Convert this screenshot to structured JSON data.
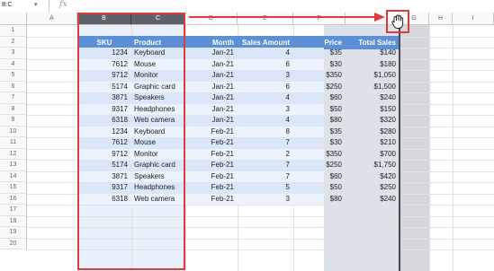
{
  "formula_bar": {
    "name_box": "B:C",
    "name_box_arrow": "▾",
    "fx_label": "fx"
  },
  "columns": [
    "A",
    "B",
    "C",
    "D",
    "E",
    "F",
    "G",
    "H",
    "I"
  ],
  "rows": [
    "1",
    "2",
    "3",
    "4",
    "5",
    "6",
    "7",
    "8",
    "9",
    "10",
    "11",
    "12",
    "13",
    "14",
    "15",
    "16",
    "17",
    "18",
    "19",
    "20"
  ],
  "table": {
    "headers": [
      "SKU",
      "Product",
      "Month",
      "Sales Amount",
      "Price",
      "Total Sales"
    ],
    "rows": [
      [
        "1234",
        "Keyboard",
        "Jan-21",
        "4",
        "$35",
        "$140"
      ],
      [
        "7612",
        "Mouse",
        "Jan-21",
        "6",
        "$30",
        "$180"
      ],
      [
        "9712",
        "Monitor",
        "Jan-21",
        "3",
        "$350",
        "$1,050"
      ],
      [
        "5174",
        "Graphic card",
        "Jan-21",
        "6",
        "$250",
        "$1,500"
      ],
      [
        "3871",
        "Speakers",
        "Jan-21",
        "4",
        "$60",
        "$240"
      ],
      [
        "9317",
        "Headphones",
        "Jan-21",
        "3",
        "$50",
        "$150"
      ],
      [
        "6318",
        "Web camera",
        "Jan-21",
        "4",
        "$80",
        "$320"
      ],
      [
        "1234",
        "Keyboard",
        "Feb-21",
        "8",
        "$35",
        "$280"
      ],
      [
        "7612",
        "Mouse",
        "Feb-21",
        "7",
        "$30",
        "$210"
      ],
      [
        "9712",
        "Monitor",
        "Feb-21",
        "2",
        "$350",
        "$700"
      ],
      [
        "5174",
        "Graphic card",
        "Feb-21",
        "7",
        "$250",
        "$1,750"
      ],
      [
        "3871",
        "Speakers",
        "Feb-21",
        "7",
        "$60",
        "$420"
      ],
      [
        "9317",
        "Headphones",
        "Feb-21",
        "5",
        "$50",
        "$250"
      ],
      [
        "6318",
        "Web camera",
        "Feb-21",
        "3",
        "$80",
        "$240"
      ]
    ]
  },
  "colors": {
    "header_blue": "#5b8fd6",
    "band_light": "#e8f0fb",
    "band_mid": "#dbe7f8",
    "selected_col_header": "#5f6368",
    "annotation_red": "#e03b3b",
    "price_shade": "#dde2ea"
  },
  "icons": {
    "move_cursor": "grab-hand-icon",
    "arrow": "right-arrow-icon"
  }
}
